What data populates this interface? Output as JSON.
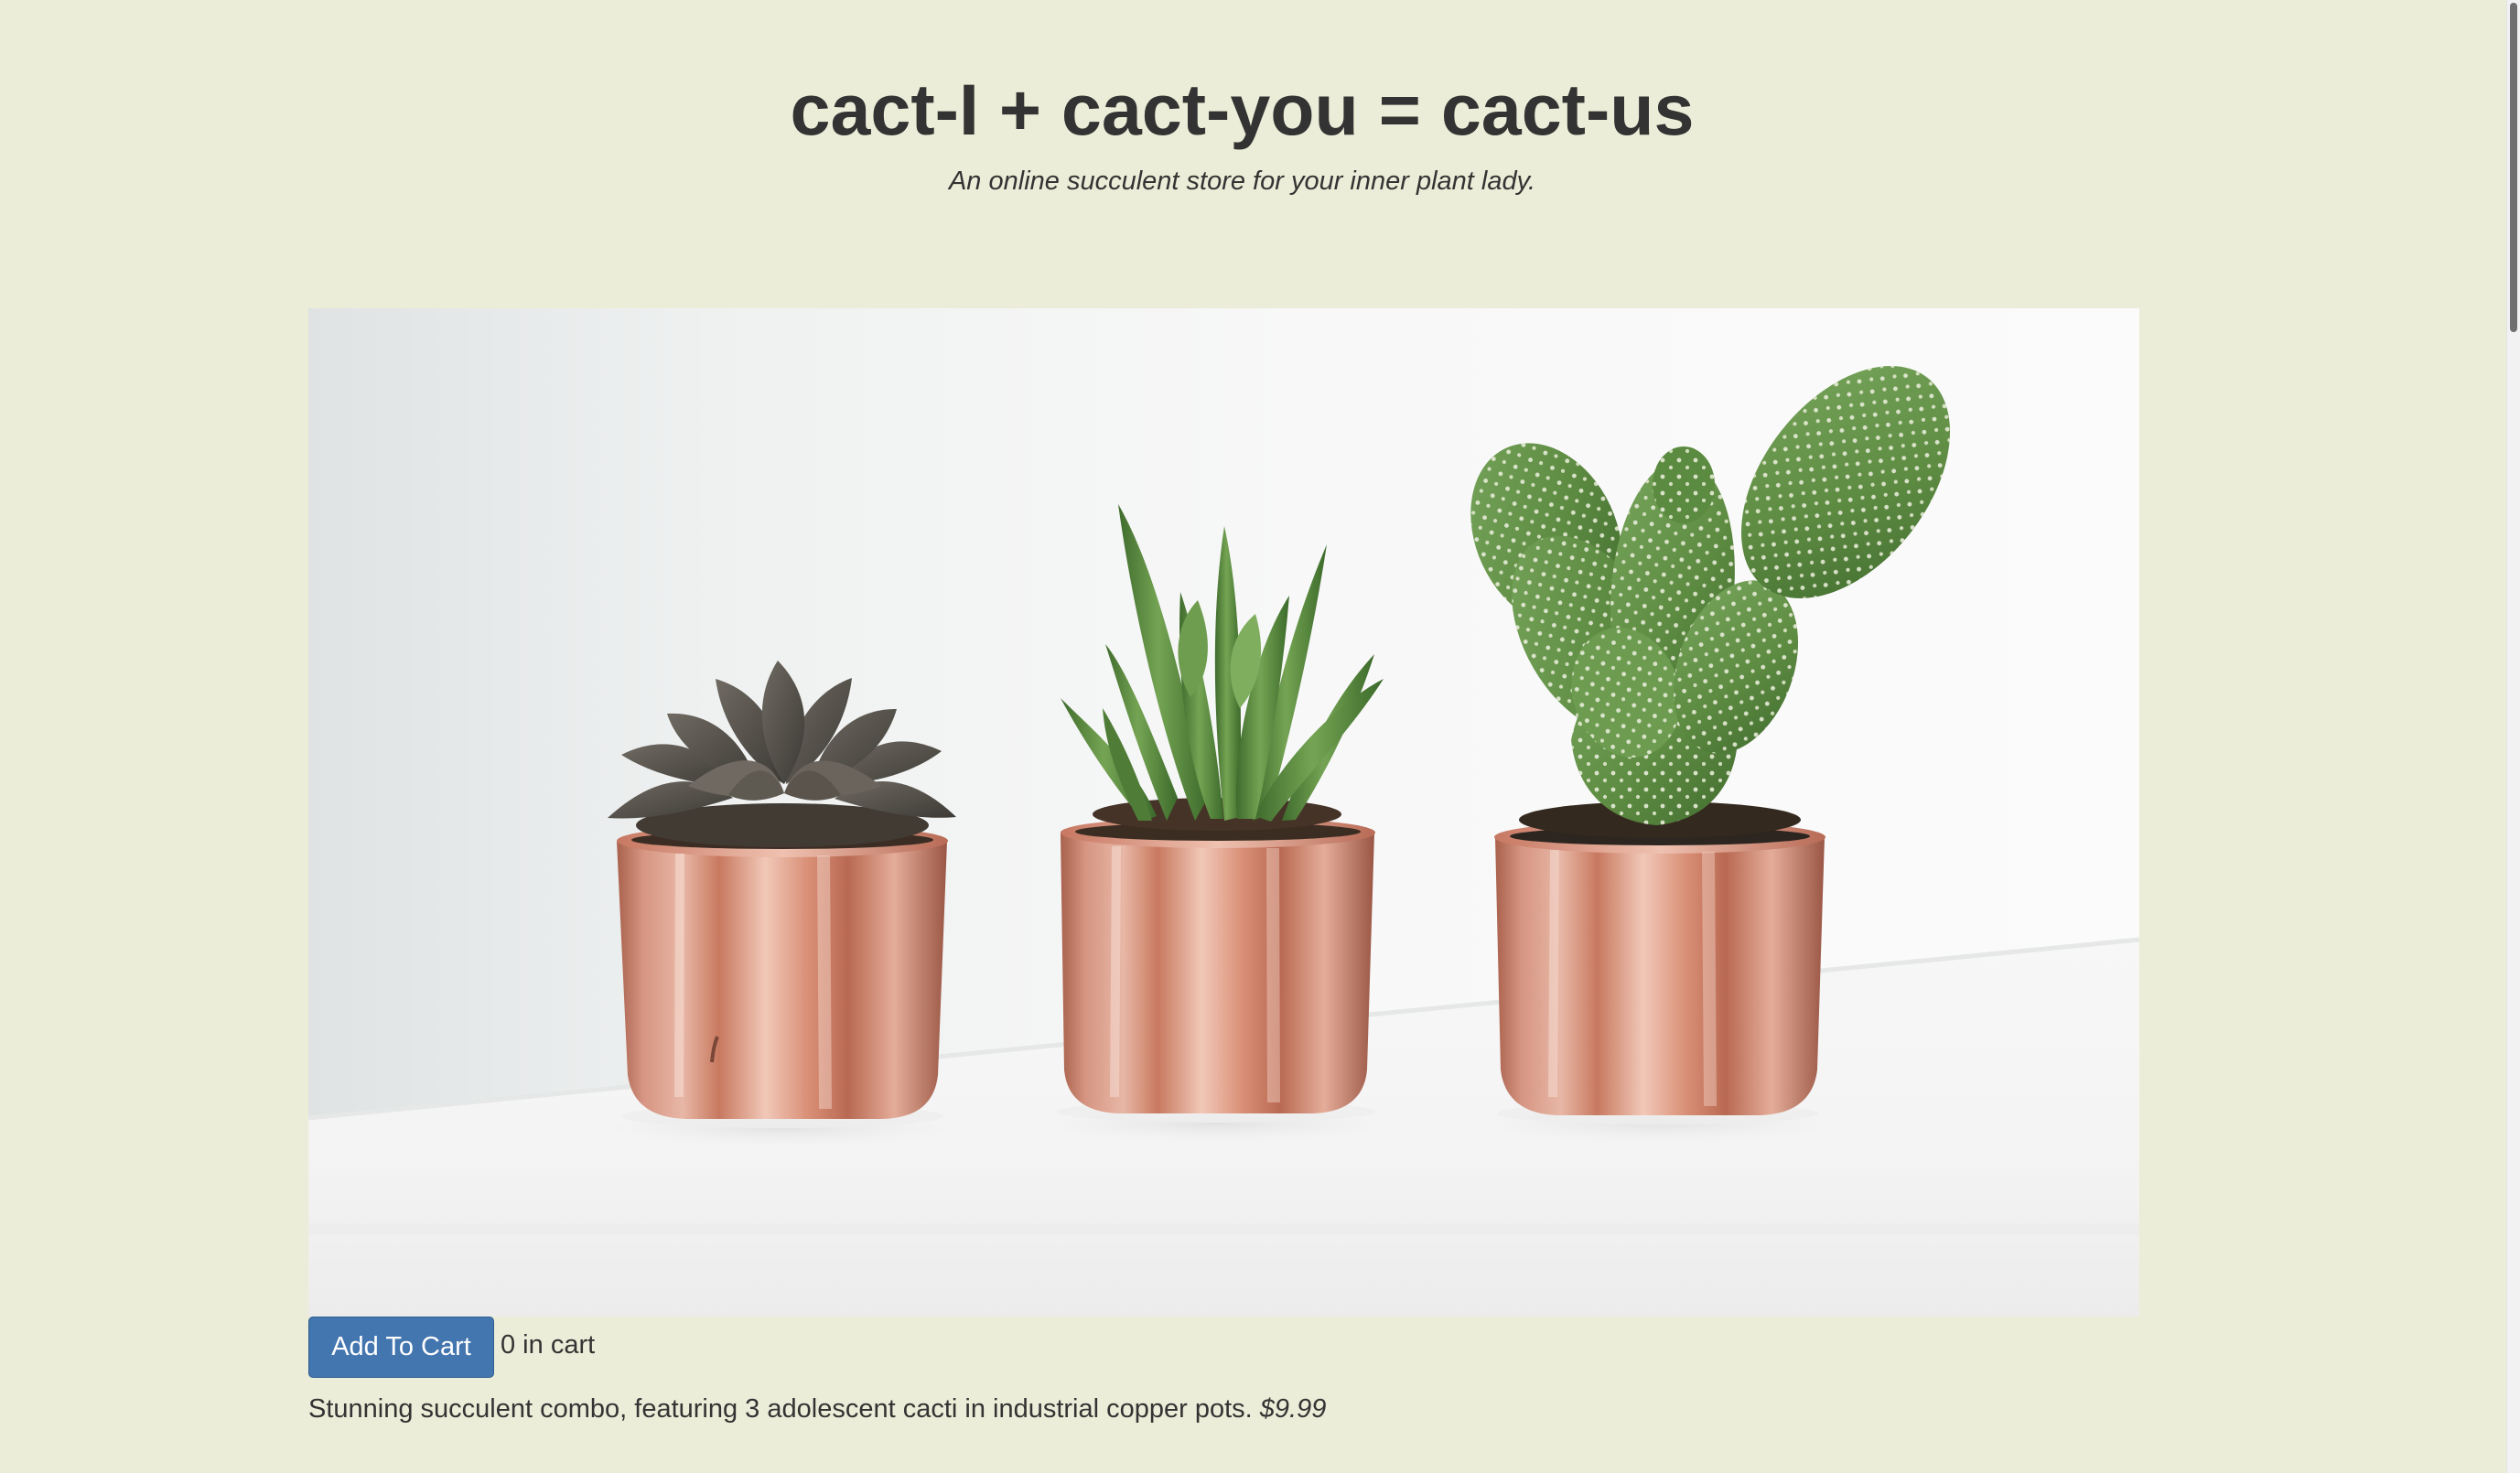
{
  "header": {
    "title": "cact-I + cact-you = cact-us",
    "subtitle": "An online succulent store for your inner plant lady."
  },
  "product": {
    "image_subject": "three succulents in copper pots",
    "add_button_label": "Add To Cart",
    "cart_count_text": "0 in cart",
    "description": "Stunning succulent combo, featuring 3 adolescent cacti in industrial copper pots.",
    "price": "$9.99"
  },
  "colors": {
    "background": "#ecedd8",
    "button": "#4375ae",
    "text": "#333333"
  }
}
